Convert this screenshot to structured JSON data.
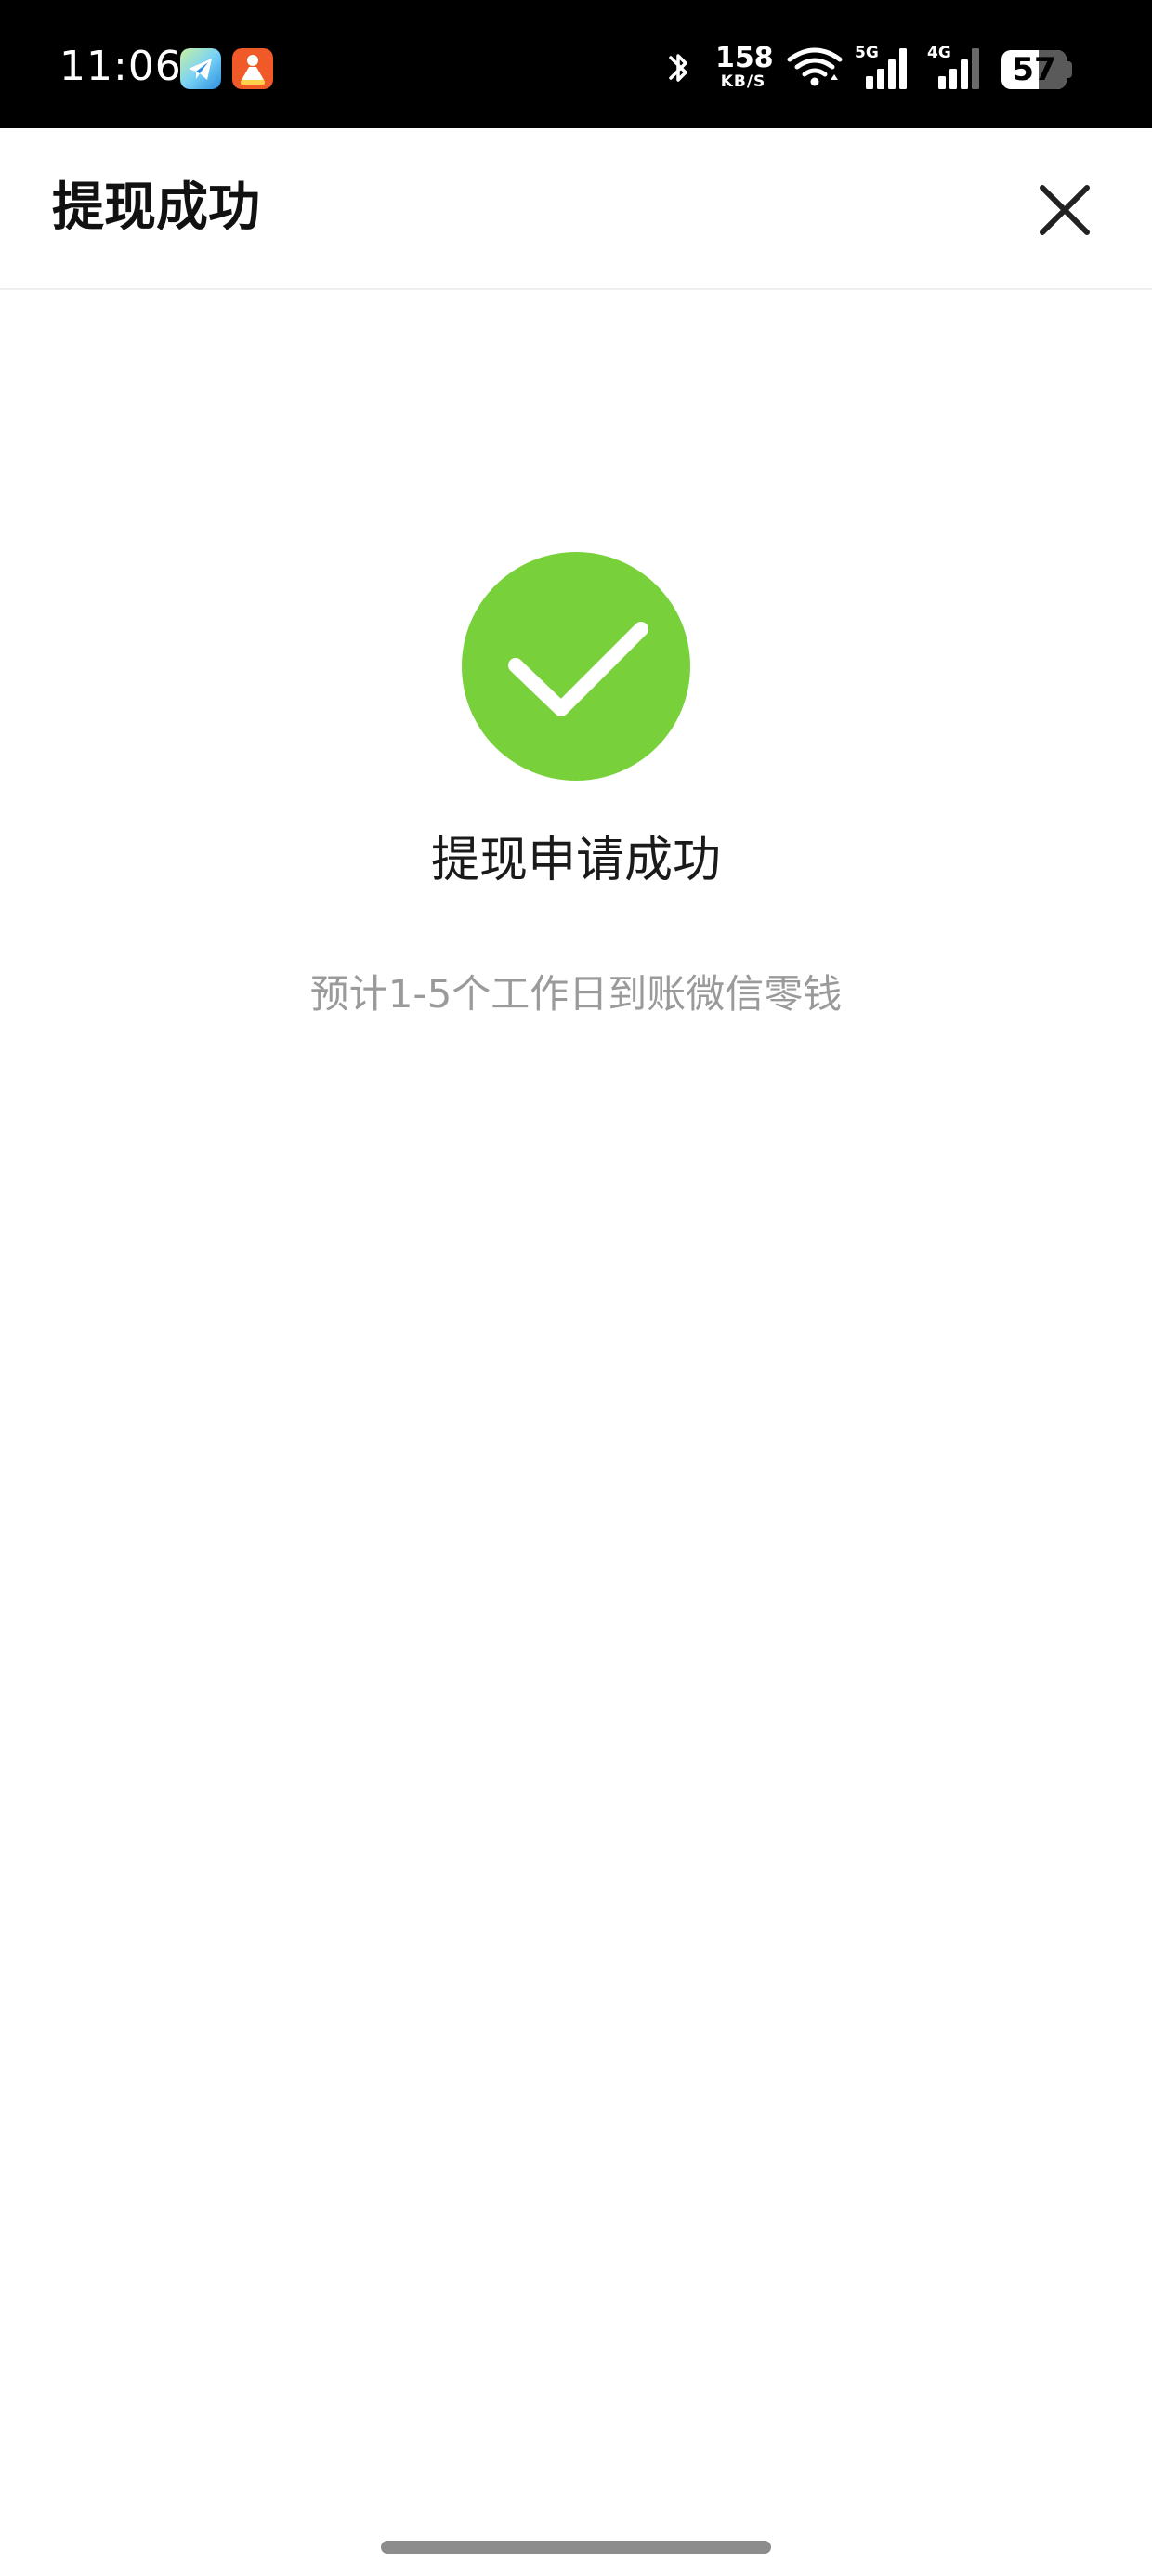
{
  "status_bar": {
    "time": "11:06",
    "net_speed_value": "158",
    "net_speed_unit": "KB/S",
    "signal_1_label": "5G",
    "signal_2_label": "4G",
    "battery_percent": "57",
    "battery_level": 0.57,
    "icons": [
      "telegram-app-icon",
      "shop-app-icon",
      "bluetooth-icon",
      "wifi-icon",
      "signal-5g-icon",
      "signal-4g-icon",
      "battery-icon"
    ]
  },
  "header": {
    "title": "提现成功",
    "close_icon": "close-icon"
  },
  "main": {
    "success_icon": "check-circle-icon",
    "success_color": "#78d13b",
    "title": "提现申请成功",
    "subtitle": "预计1-5个工作日到账微信零钱"
  }
}
